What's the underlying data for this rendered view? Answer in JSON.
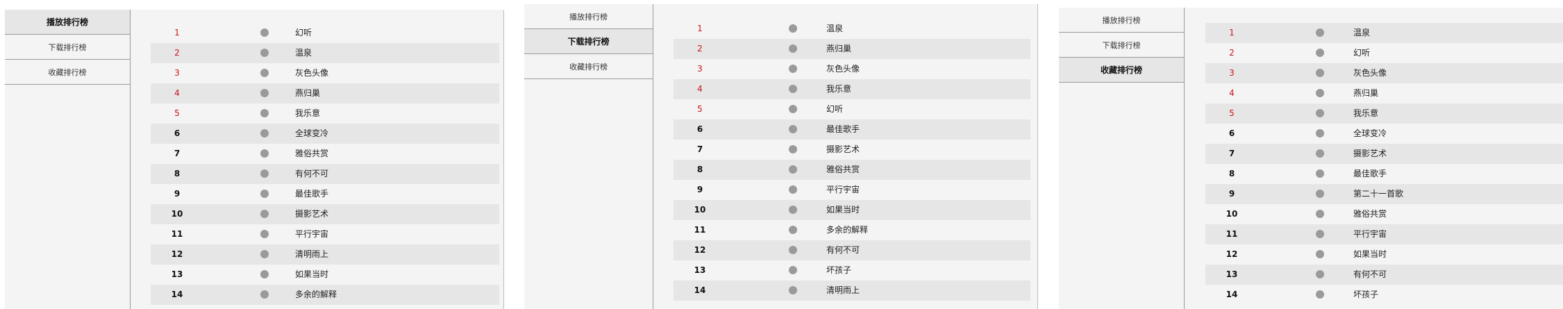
{
  "tabs": [
    "播放排行榜",
    "下载排行榜",
    "收藏排行榜"
  ],
  "panels": [
    {
      "name": "play-ranking",
      "active_tab": 0,
      "songs": [
        "幻听",
        "温泉",
        "灰色头像",
        "燕归巢",
        "我乐意",
        "全球变冷",
        "雅俗共赏",
        "有何不可",
        "最佳歌手",
        "摄影艺术",
        "平行宇宙",
        "清明雨上",
        "如果当时",
        "多余的解释"
      ]
    },
    {
      "name": "download-ranking",
      "active_tab": 1,
      "songs": [
        "温泉",
        "燕归巢",
        "灰色头像",
        "我乐意",
        "幻听",
        "最佳歌手",
        "摄影艺术",
        "雅俗共赏",
        "平行宇宙",
        "如果当时",
        "多余的解释",
        "有何不可",
        "坏孩子",
        "清明雨上"
      ]
    },
    {
      "name": "favorite-ranking",
      "active_tab": 2,
      "songs": [
        "温泉",
        "幻听",
        "灰色头像",
        "燕归巢",
        "我乐意",
        "全球变冷",
        "摄影艺术",
        "最佳歌手",
        "第二十一首歌",
        "雅俗共赏",
        "平行宇宙",
        "如果当时",
        "有何不可",
        "坏孩子"
      ]
    }
  ],
  "ranks": [
    "1",
    "2",
    "3",
    "4",
    "5",
    "6",
    "7",
    "8",
    "9",
    "10",
    "11",
    "12",
    "13",
    "14"
  ],
  "colors": {
    "top_rank": "#c8161d",
    "row_alt": "#e6e6e6",
    "panel_bg": "#f4f4f4",
    "dot": "#9a9a9a"
  },
  "icons": {
    "row_marker": "dot-icon"
  }
}
